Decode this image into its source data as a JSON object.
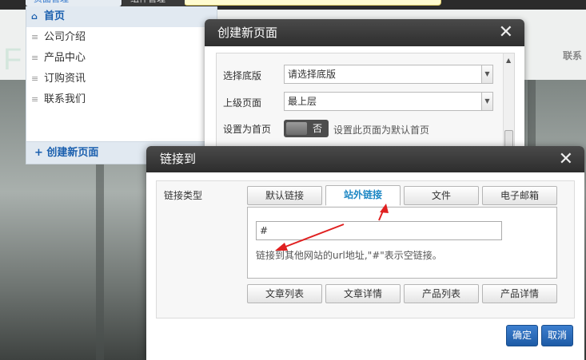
{
  "background": {
    "logo_text": "F",
    "nav_text": "联系"
  },
  "page_manager": {
    "tab_label": "页面管理",
    "tab2_label": "组件管理",
    "items": [
      {
        "label": "首页",
        "active": true
      },
      {
        "label": "公司介绍",
        "active": false
      },
      {
        "label": "产品中心",
        "active": false
      },
      {
        "label": "订购资讯",
        "active": false
      },
      {
        "label": "联系我们",
        "active": false
      }
    ],
    "create_button": "+ 创建新页面"
  },
  "create_page_dialog": {
    "title": "创建新页面",
    "close": "✕",
    "template_label": "选择底版",
    "template_value": "请选择底版",
    "parent_label": "上级页面",
    "parent_value": "最上层",
    "homepage_label": "设置为首页",
    "homepage_toggle": "否",
    "homepage_hint": "设置此页面为默认首页"
  },
  "link_dialog": {
    "title": "链接到",
    "close": "✕",
    "type_label": "链接类型",
    "tabs": [
      {
        "label": "默认链接",
        "active": false
      },
      {
        "label": "站外链接",
        "active": true
      },
      {
        "label": "文件",
        "active": false
      },
      {
        "label": "电子邮箱",
        "active": false
      }
    ],
    "url_value": "#",
    "hint": "链接到其他网站的url地址,\"#\"表示空链接。",
    "bottom_buttons": [
      "文章列表",
      "文章详情",
      "产品列表",
      "产品详情"
    ],
    "confirm": "确定",
    "cancel": "取消"
  },
  "colors": {
    "accent_blue": "#1d87c4",
    "primary_button": "#2a6bbb",
    "annotation_red": "#e02020"
  }
}
